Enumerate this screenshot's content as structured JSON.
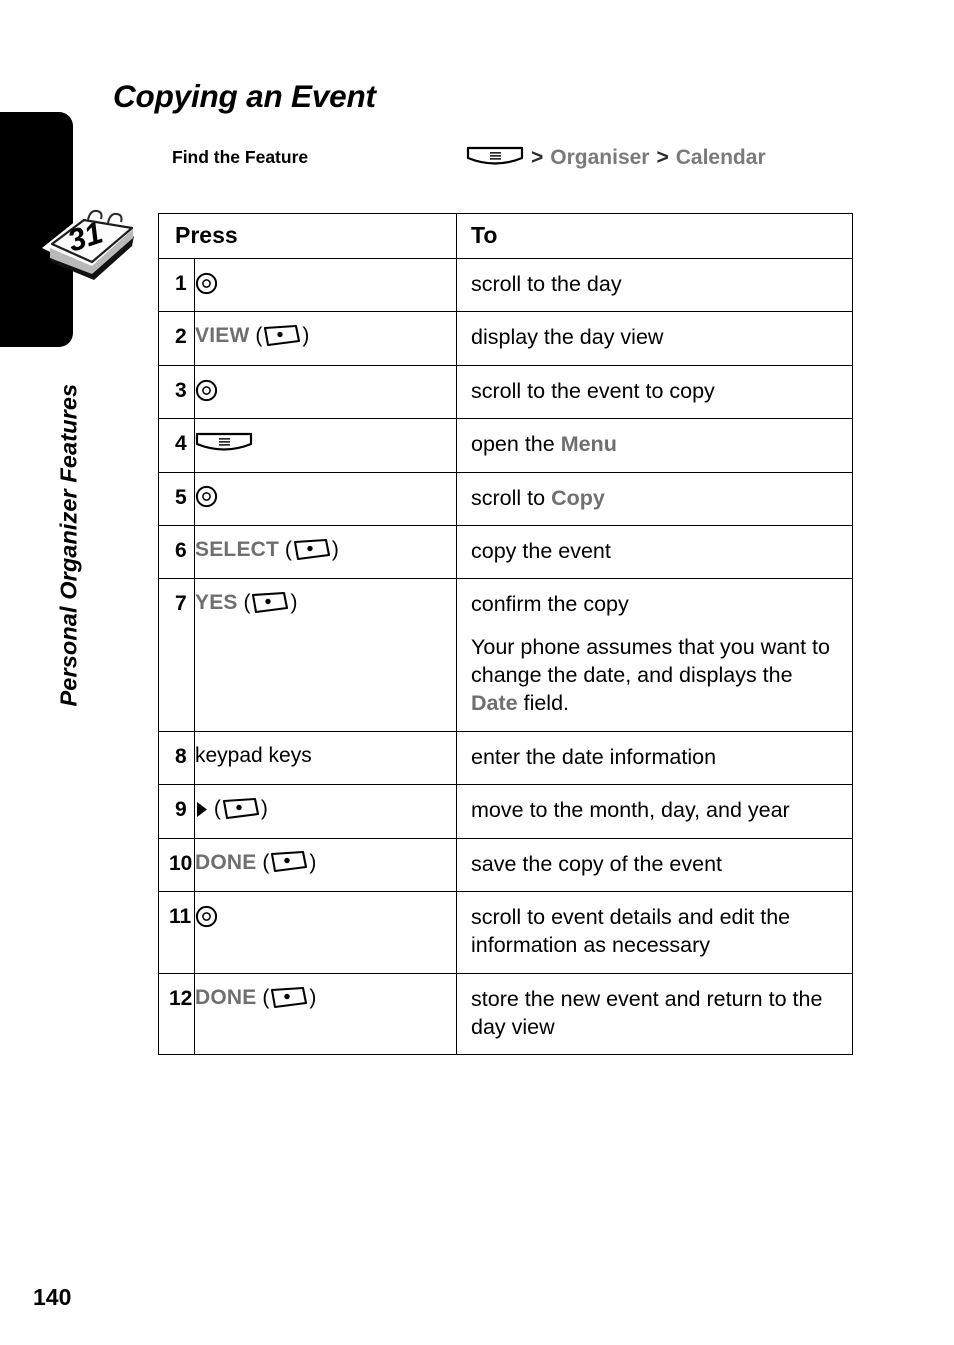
{
  "page": {
    "number": "140",
    "running_head": "Personal Organizer Features",
    "title": "Copying an Event",
    "tab_icon": "calendar-31-icon",
    "calendar_day": "31"
  },
  "find_the_feature": {
    "label": "Find the Feature",
    "menu_icon": "menu-key-icon",
    "separator": ">",
    "path": [
      "Organiser",
      "Calendar"
    ]
  },
  "table": {
    "headers": {
      "press": "Press",
      "to": "To"
    },
    "rows": [
      {
        "num": "1",
        "press_icons": [
          "nav-key-icon"
        ],
        "press_label": "",
        "to": "scroll to the day"
      },
      {
        "num": "2",
        "press_icons": [
          "soft-key-icon"
        ],
        "press_label": "VIEW",
        "to": "display the day view"
      },
      {
        "num": "3",
        "press_icons": [
          "nav-key-icon"
        ],
        "press_label": "",
        "to": "scroll to the event to copy"
      },
      {
        "num": "4",
        "press_icons": [
          "menu-key-icon"
        ],
        "press_label": "",
        "to_prefix": "open the ",
        "to_term": "Menu"
      },
      {
        "num": "5",
        "press_icons": [
          "nav-key-icon"
        ],
        "press_label": "",
        "to_prefix": "scroll to ",
        "to_term": "Copy"
      },
      {
        "num": "6",
        "press_icons": [
          "soft-key-icon"
        ],
        "press_label": "SELECT",
        "to": "copy the event"
      },
      {
        "num": "7",
        "press_icons": [
          "soft-key-icon"
        ],
        "press_label": "YES",
        "to": "confirm the copy",
        "note_prefix": "Your phone assumes that you want to change the date, and displays the ",
        "note_term": "Date",
        "note_suffix": " field."
      },
      {
        "num": "8",
        "press_icons": [],
        "press_label": "keypad keys",
        "press_label_style": "plain",
        "to": "enter the date information"
      },
      {
        "num": "9",
        "press_icons": [
          "right-arrow-icon",
          "soft-key-icon"
        ],
        "press_label": "",
        "to": "move to the month, day, and year"
      },
      {
        "num": "10",
        "press_icons": [
          "soft-key-icon"
        ],
        "press_label": "DONE",
        "to": "save the copy of the event"
      },
      {
        "num": "11",
        "press_icons": [
          "nav-key-icon"
        ],
        "press_label": "",
        "to": "scroll to event details and edit the information as necessary"
      },
      {
        "num": "12",
        "press_icons": [
          "soft-key-icon"
        ],
        "press_label": "DONE",
        "to": "store the new event and return to the day view"
      }
    ]
  },
  "colors": {
    "key_label_gray": "#6f6f6f",
    "path_gray": "#7a7a7a",
    "ink": "#000000",
    "tab_black": "#000000"
  }
}
